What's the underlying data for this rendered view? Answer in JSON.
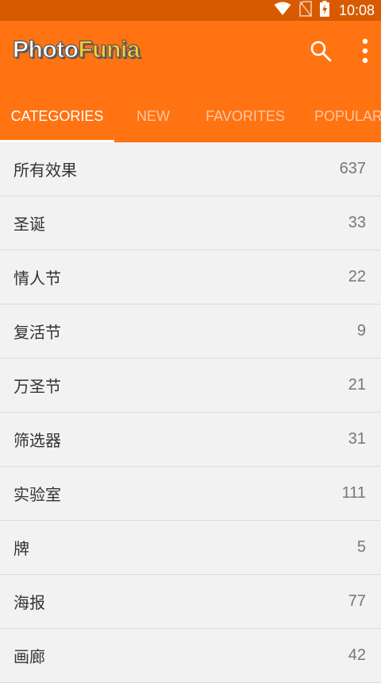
{
  "status_bar": {
    "time": "10:08",
    "icons": [
      "wifi-icon",
      "no-sim-icon",
      "battery-charging-icon"
    ]
  },
  "app_bar": {
    "logo_part1": "Photo",
    "logo_part2": "Funia",
    "actions": [
      "search-icon",
      "more-vert-icon"
    ],
    "accent_color": "#ff7312"
  },
  "tabs": [
    {
      "label": "CATEGORIES",
      "active": true
    },
    {
      "label": "NEW",
      "active": false
    },
    {
      "label": "FAVORITES",
      "active": false
    },
    {
      "label": "POPULAR",
      "active": false
    }
  ],
  "categories": [
    {
      "name": "所有效果",
      "count": "637"
    },
    {
      "name": "圣诞",
      "count": "33"
    },
    {
      "name": "情人节",
      "count": "22"
    },
    {
      "name": "复活节",
      "count": "9"
    },
    {
      "name": "万圣节",
      "count": "21"
    },
    {
      "name": "筛选器",
      "count": "31"
    },
    {
      "name": "实验室",
      "count": "111"
    },
    {
      "name": "牌",
      "count": "5"
    },
    {
      "name": "海报",
      "count": "77"
    },
    {
      "name": "画廊",
      "count": "42"
    }
  ]
}
